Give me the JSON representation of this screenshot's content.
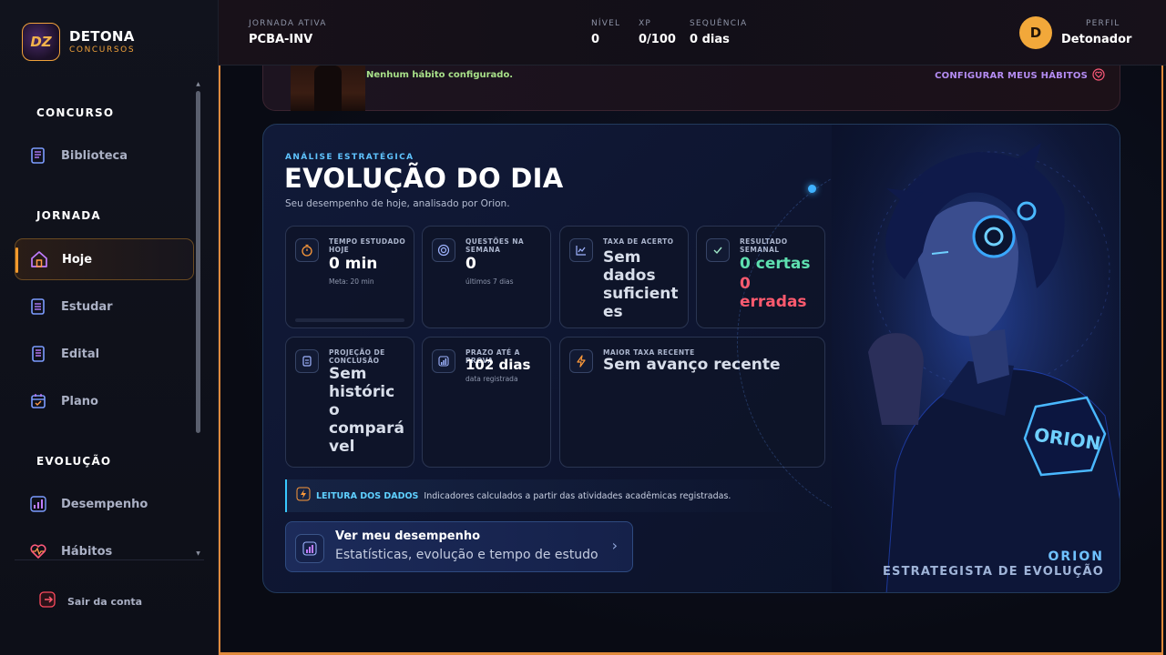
{
  "brand": {
    "title": "DETONA",
    "subtitle": "CONCURSOS",
    "logo_text": "DZ"
  },
  "sidebar": {
    "sections": [
      {
        "label": "CONCURSO"
      },
      {
        "label": "JORNADA"
      },
      {
        "label": "EVOLUÇÃO"
      }
    ],
    "items": [
      {
        "label": "Biblioteca",
        "icon": "book-icon"
      },
      {
        "label": "Hoje",
        "icon": "home-icon",
        "active": true
      },
      {
        "label": "Estudar",
        "icon": "notebook-icon"
      },
      {
        "label": "Edital",
        "icon": "document-icon"
      },
      {
        "label": "Plano",
        "icon": "calendar-icon"
      },
      {
        "label": "Desempenho",
        "icon": "bar-chart-icon"
      },
      {
        "label": "Hábitos",
        "icon": "heart-pulse-icon"
      }
    ],
    "logout_label": "Sair da conta"
  },
  "topbar": {
    "journey_label": "JORNADA ATIVA",
    "journey_value": "PCBA-INV",
    "level_label": "NÍVEL",
    "level_value": "0",
    "xp_label": "XP",
    "xp_value": "0/100",
    "streak_label": "SEQUÊNCIA",
    "streak_value": "0 dias",
    "avatar_initial": "D",
    "profile_label": "PERFIL",
    "profile_name": "Detonador"
  },
  "habits": {
    "message": "Nenhum hábito configurado.",
    "link_label": "CONFIGURAR MEUS HÁBITOS"
  },
  "evolution": {
    "eyebrow": "ANÁLISE ESTRATÉGICA",
    "title": "EVOLUÇÃO DO DIA",
    "subtitle": "Seu desempenho de hoje, analisado por Orion.",
    "stats": {
      "study_time": {
        "label1": "TEMPO ESTUDADO",
        "label2": "HOJE",
        "value": "0 min",
        "note": "Meta: 20 min",
        "progress": 0
      },
      "week_questions": {
        "label1": "QUESTÕES NA",
        "label2": "SEMANA",
        "value": "0",
        "note": "últimos 7 dias"
      },
      "accuracy": {
        "label1": "TAXA DE ACERTO",
        "value_lines": [
          "Sem",
          "dados",
          "suficient",
          "es"
        ]
      },
      "weekly_result": {
        "label1": "RESULTADO",
        "label2": "SEMANAL",
        "correct": "0 certas",
        "wrong_num": "0",
        "wrong_word": "erradas"
      },
      "projection": {
        "label1": "PROJEÇÃO DE",
        "label2": "CONCLUSÃO",
        "value_lines": [
          "Sem",
          "históric",
          "o",
          "compará",
          "vel"
        ]
      },
      "deadline": {
        "label1": "PRAZO ATÉ A PROVA",
        "value": "102 dias",
        "note": "data registrada"
      },
      "top_rate": {
        "label1": "MAIOR TAXA RECENTE",
        "value": "Sem avanço recente"
      }
    },
    "insight": {
      "key": "LEITURA DOS DADOS",
      "text": "Indicadores calculados a partir das atividades acadêmicas registradas."
    },
    "performance_button": {
      "title": "Ver meu desempenho",
      "subtitle": "Estatísticas, evolução e tempo de estudo"
    },
    "orion": {
      "badge": "ORION",
      "name": "ORION",
      "role": "ESTRATEGISTA DE EVOLUÇÃO"
    }
  },
  "colors": {
    "accent_orange": "#f39a2c",
    "accent_cyan": "#5fc4ff",
    "correct_green": "#5ee0b0",
    "wrong_red": "#ff5a6e",
    "habits_green": "#a8e089",
    "habits_link_purple": "#b48cf2"
  }
}
